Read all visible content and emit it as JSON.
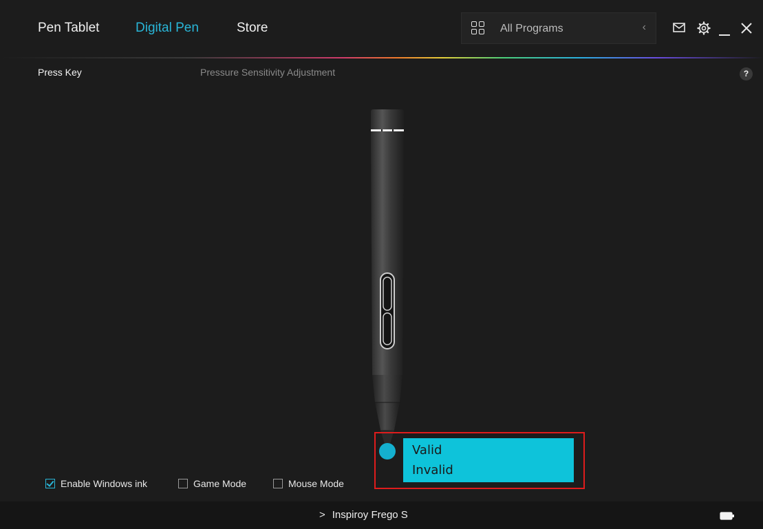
{
  "nav": {
    "tabs": [
      {
        "label": "Pen Tablet",
        "active": false
      },
      {
        "label": "Digital Pen",
        "active": true
      },
      {
        "label": "Store",
        "active": false
      }
    ]
  },
  "search": {
    "placeholder": "All Programs",
    "icon": "grid-icon",
    "collapse_icon": "chevron-left-icon"
  },
  "window_controls": [
    "mail-icon",
    "gear-icon",
    "minimize-icon",
    "close-icon"
  ],
  "subnav": {
    "active_label": "Press Key",
    "inactive_label": "Pressure Sensitivity Adjustment",
    "help_label": "?"
  },
  "pen_tip_menu": {
    "options": [
      "Valid",
      "Invalid"
    ]
  },
  "options": {
    "windows_ink": {
      "label": "Enable Windows ink",
      "checked": true
    },
    "game_mode": {
      "label": "Game Mode",
      "checked": false
    },
    "mouse_mode": {
      "label": "Mouse Mode",
      "checked": false
    }
  },
  "status": {
    "device_name": "Inspiroy Frego S",
    "chevron": ">",
    "battery_icon": "battery-icon"
  },
  "colors": {
    "accent": "#29b6d8",
    "menu_bg": "#0ec3da",
    "highlight_frame": "#e01c1c",
    "background": "#1c1c1c"
  }
}
